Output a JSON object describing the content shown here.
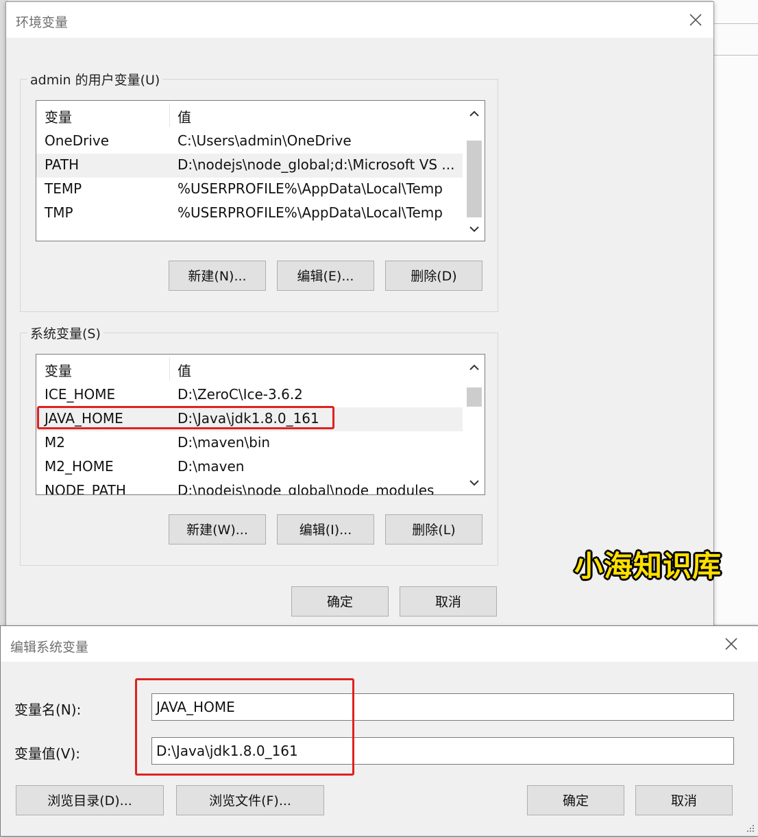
{
  "env_dialog": {
    "title": "环境变量",
    "user_group": {
      "title": "admin 的用户变量(U)",
      "col_name": "变量",
      "col_value": "值",
      "rows": [
        {
          "name": "OneDrive",
          "value": "C:\\Users\\admin\\OneDrive"
        },
        {
          "name": "PATH",
          "value": "D:\\nodejs\\node_global;d:\\Microsoft VS ..."
        },
        {
          "name": "TEMP",
          "value": "%USERPROFILE%\\AppData\\Local\\Temp"
        },
        {
          "name": "TMP",
          "value": "%USERPROFILE%\\AppData\\Local\\Temp"
        }
      ],
      "new_label": "新建(N)...",
      "edit_label": "编辑(E)...",
      "delete_label": "删除(D)"
    },
    "system_group": {
      "title": "系统变量(S)",
      "col_name": "变量",
      "col_value": "值",
      "rows": [
        {
          "name": "ICE_HOME",
          "value": "D:\\ZeroC\\Ice-3.6.2"
        },
        {
          "name": "JAVA_HOME",
          "value": "D:\\Java\\jdk1.8.0_161"
        },
        {
          "name": "M2",
          "value": "D:\\maven\\bin"
        },
        {
          "name": "M2_HOME",
          "value": "D:\\maven"
        },
        {
          "name": "NODE_PATH",
          "value": "D:\\nodejs\\node_global\\node_modules"
        }
      ],
      "new_label": "新建(W)...",
      "edit_label": "编辑(I)...",
      "delete_label": "删除(L)"
    },
    "ok_label": "确定",
    "cancel_label": "取消"
  },
  "edit_dialog": {
    "title": "编辑系统变量",
    "name_label": "变量名(N):",
    "name_value": "JAVA_HOME",
    "value_label": "变量值(V):",
    "value_value": "D:\\Java\\jdk1.8.0_161",
    "browse_dir_label": "浏览目录(D)...",
    "browse_file_label": "浏览文件(F)...",
    "ok_label": "确定",
    "cancel_label": "取消"
  },
  "watermark": "小海知识库",
  "colors": {
    "highlight": "#e02020",
    "watermark": "#ffe000"
  }
}
